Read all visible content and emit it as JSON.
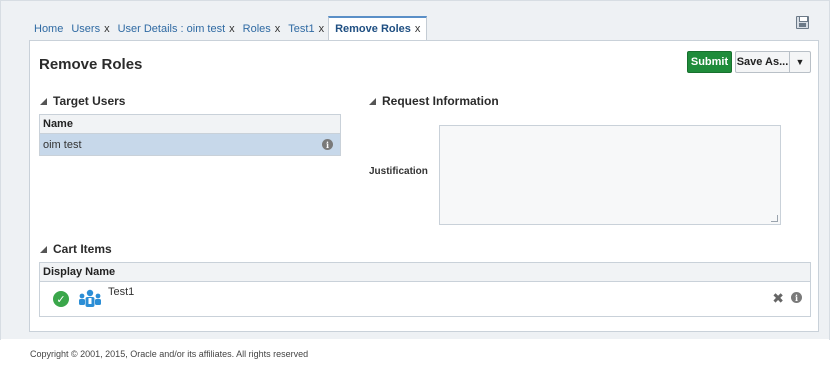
{
  "tabs": [
    {
      "label": "Home",
      "closable": false
    },
    {
      "label": "Users",
      "closable": true
    },
    {
      "label": "User Details : oim test",
      "closable": true
    },
    {
      "label": "Roles",
      "closable": true
    },
    {
      "label": "Test1",
      "closable": true
    },
    {
      "label": "Remove Roles",
      "closable": true,
      "active": true
    }
  ],
  "close_glyph": "x",
  "page": {
    "title": "Remove Roles",
    "submit_label": "Submit",
    "save_as_label": "Save As...",
    "dropdown_glyph": "▼"
  },
  "target_users": {
    "heading": "Target Users",
    "column": "Name",
    "rows": [
      {
        "name": "oim test",
        "selected": true
      }
    ]
  },
  "request_info": {
    "heading": "Request Information",
    "justification_label": "Justification",
    "justification_value": ""
  },
  "cart": {
    "heading": "Cart Items",
    "column": "Display Name",
    "items": [
      {
        "name": "Test1",
        "status": "ok"
      }
    ],
    "remove_glyph": "✖",
    "info_glyph": "i",
    "check_glyph": "✓"
  },
  "footer": {
    "copyright": "Copyright © 2001, 2015, Oracle and/or its affiliates. All rights reserved"
  },
  "colors": {
    "accent_link": "#2f6aa3",
    "submit_green": "#1f8c3b",
    "selected_row": "#c7d8ea",
    "role_icon_blue": "#2c8ed6"
  }
}
